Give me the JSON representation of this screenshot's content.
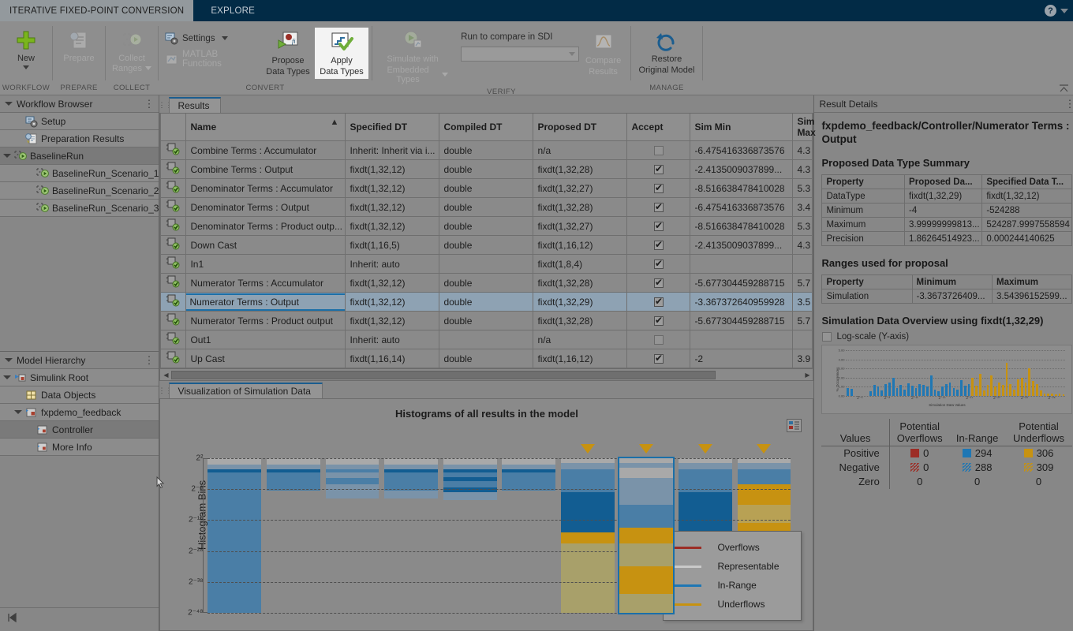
{
  "titlebar": {
    "active_tab": "ITERATIVE FIXED-POINT CONVERSION",
    "inactive_tab": "EXPLORE",
    "help_icon": "question-mark-icon"
  },
  "ribbon": {
    "groups": [
      {
        "label": "WORKFLOW",
        "items": [
          {
            "label_line1": "New",
            "label_line2": "",
            "state": "enabled",
            "dropdown": true,
            "icon": "green-plus-icon"
          }
        ]
      },
      {
        "label": "PREPARE",
        "items": [
          {
            "label_line1": "Prepare",
            "label_line2": "",
            "state": "disabled",
            "dropdown": false,
            "icon": "prepare-document-icon"
          }
        ]
      },
      {
        "label": "COLLECT",
        "items": [
          {
            "label_line1": "Collect",
            "label_line2": "Ranges",
            "state": "disabled",
            "dropdown": true,
            "icon": "collect-ranges-icon"
          }
        ]
      },
      {
        "label": "CONVERT",
        "items": [
          {
            "label_line1": "Settings",
            "state": "enabled",
            "dropdown": true,
            "icon": "settings-gear-icon",
            "kind": "small"
          },
          {
            "label_line1": "MATLAB Functions",
            "state": "disabled",
            "dropdown": false,
            "icon": "matlab-icon",
            "kind": "small"
          },
          {
            "label_line1": "Propose",
            "label_line2": "Data Types",
            "state": "enabled",
            "icon": "propose-data-types-icon",
            "kind": "big"
          },
          {
            "label_line1": "Apply",
            "label_line2": "Data Types",
            "state": "selected",
            "icon": "apply-data-types-icon",
            "kind": "big"
          }
        ]
      },
      {
        "label": "VERIFY",
        "items": [
          {
            "label_line1": "Simulate with",
            "label_line2": "Embedded Types",
            "state": "disabled",
            "dropdown": true,
            "icon": "simulate-icon",
            "kind": "big"
          },
          {
            "label_line1": "Run to compare in SDI",
            "kind": "combo-label"
          },
          {
            "label_line1": "Compare",
            "label_line2": "Results",
            "state": "disabled",
            "icon": "compare-results-icon",
            "kind": "big"
          }
        ]
      },
      {
        "label": "MANAGE",
        "items": [
          {
            "label_line1": "Restore",
            "label_line2": "Original Model",
            "state": "enabled",
            "icon": "restore-original-model-icon",
            "kind": "big"
          }
        ]
      }
    ],
    "sdi_combo_value": "",
    "sdi_combo_placeholder": ""
  },
  "workflow_browser": {
    "title": "Workflow Browser",
    "items": [
      {
        "label": "Setup",
        "icon": "setup-gear-icon",
        "indent": 1,
        "expandable": false,
        "selected": false
      },
      {
        "label": "Preparation Results",
        "icon": "preparation-results-icon",
        "indent": 1,
        "expandable": false,
        "selected": false
      },
      {
        "label": "BaselineRun",
        "icon": "run-icon",
        "indent": 0,
        "expandable": true,
        "selected": true
      },
      {
        "label": "BaselineRun_Scenario_1",
        "icon": "run-icon",
        "indent": 2,
        "expandable": false,
        "selected": false
      },
      {
        "label": "BaselineRun_Scenario_2",
        "icon": "run-icon",
        "indent": 2,
        "expandable": false,
        "selected": false
      },
      {
        "label": "BaselineRun_Scenario_3",
        "icon": "run-icon",
        "indent": 2,
        "expandable": false,
        "selected": false
      }
    ]
  },
  "model_hierarchy": {
    "title": "Model Hierarchy",
    "items": [
      {
        "label": "Simulink Root",
        "icon": "simulink-root-icon",
        "indent": 0,
        "expandable": true,
        "selected": false
      },
      {
        "label": "Data Objects",
        "icon": "data-objects-icon",
        "indent": 1,
        "expandable": false,
        "selected": false
      },
      {
        "label": "fxpdemo_feedback",
        "icon": "model-icon",
        "indent": 1,
        "expandable": true,
        "selected": false
      },
      {
        "label": "Controller",
        "icon": "subsystem-icon",
        "indent": 2,
        "expandable": false,
        "selected": true
      },
      {
        "label": "More Info",
        "icon": "subsystem-icon",
        "indent": 2,
        "expandable": false,
        "selected": false
      }
    ]
  },
  "results_tab": {
    "label": "Results",
    "columns": [
      "Name",
      "Specified DT",
      "Compiled DT",
      "Proposed DT",
      "Accept",
      "Sim Min",
      "Sim Max"
    ],
    "sorted_column": "Name",
    "sort_direction": "ascending",
    "rows": [
      {
        "name": "Combine Terms : Accumulator",
        "specified": "Inherit: Inherit via i...",
        "compiled": "double",
        "proposed": "n/a",
        "accept": false,
        "simmin": "-6.475416336873576",
        "simmax": "4.3",
        "selected": false
      },
      {
        "name": "Combine Terms : Output",
        "specified": "fixdt(1,32,12)",
        "compiled": "double",
        "proposed": "fixdt(1,32,28)",
        "accept": true,
        "simmin": "-2.4135009037899...",
        "simmax": "4.3",
        "selected": false
      },
      {
        "name": "Denominator Terms : Accumulator",
        "specified": "fixdt(1,32,12)",
        "compiled": "double",
        "proposed": "fixdt(1,32,27)",
        "accept": true,
        "simmin": "-8.516638478410028",
        "simmax": "5.3",
        "selected": false
      },
      {
        "name": "Denominator Terms : Output",
        "specified": "fixdt(1,32,12)",
        "compiled": "double",
        "proposed": "fixdt(1,32,28)",
        "accept": true,
        "simmin": "-6.475416336873576",
        "simmax": "3.4",
        "selected": false
      },
      {
        "name": "Denominator Terms : Product outp...",
        "specified": "fixdt(1,32,12)",
        "compiled": "double",
        "proposed": "fixdt(1,32,27)",
        "accept": true,
        "simmin": "-8.516638478410028",
        "simmax": "5.3",
        "selected": false
      },
      {
        "name": "Down Cast",
        "specified": "fixdt(1,16,5)",
        "compiled": "double",
        "proposed": "fixdt(1,16,12)",
        "accept": true,
        "simmin": "-2.4135009037899...",
        "simmax": "4.3",
        "selected": false
      },
      {
        "name": "In1",
        "specified": "Inherit: auto",
        "compiled": "",
        "proposed": "fixdt(1,8,4)",
        "accept": true,
        "simmin": "",
        "simmax": "",
        "selected": false
      },
      {
        "name": "Numerator Terms : Accumulator",
        "specified": "fixdt(1,32,12)",
        "compiled": "double",
        "proposed": "fixdt(1,32,28)",
        "accept": true,
        "simmin": "-5.677304459288715",
        "simmax": "5.7",
        "selected": false
      },
      {
        "name": "Numerator Terms : Output",
        "specified": "fixdt(1,32,12)",
        "compiled": "double",
        "proposed": "fixdt(1,32,29)",
        "accept": true,
        "simmin": "-3.367372640959928",
        "simmax": "3.5",
        "selected": true
      },
      {
        "name": "Numerator Terms : Product output",
        "specified": "fixdt(1,32,12)",
        "compiled": "double",
        "proposed": "fixdt(1,32,28)",
        "accept": true,
        "simmin": "-5.677304459288715",
        "simmax": "5.7",
        "selected": false
      },
      {
        "name": "Out1",
        "specified": "Inherit: auto",
        "compiled": "",
        "proposed": "n/a",
        "accept": false,
        "simmin": "",
        "simmax": "",
        "selected": false
      },
      {
        "name": "Up Cast",
        "specified": "fixdt(1,16,14)",
        "compiled": "double",
        "proposed": "fixdt(1,16,12)",
        "accept": true,
        "simmin": "-2",
        "simmax": "3.9",
        "selected": false
      }
    ]
  },
  "visualization": {
    "tab_label": "Visualization of Simulation Data",
    "legend_button_icon": "legend-toggle-icon",
    "chart_data": {
      "type": "heatmap",
      "title": "Histograms of all results in the model",
      "xlabel": "",
      "ylabel": "Histogram Bins",
      "ytick_labels": [
        "2²",
        "2⁻⁸",
        "2⁻¹⁸",
        "2⁻²⁸",
        "2⁻³⁸",
        "2⁻⁴⁸"
      ],
      "ytick_exponents": [
        2,
        -8,
        -18,
        -28,
        -38,
        -48
      ],
      "grid": true,
      "legend_position": "bottom-right",
      "legend": [
        {
          "label": "Overflows",
          "color": "#9c2d26"
        },
        {
          "label": "Representable",
          "color": "#c9c9c9"
        },
        {
          "label": "In-Range",
          "color": "#1f77b4"
        },
        {
          "label": "Underflows",
          "color": "#c79211"
        }
      ],
      "marker_columns": [
        7,
        8,
        9,
        10
      ],
      "selected_column": 8,
      "columns": [
        {
          "index": 1,
          "segments": [
            [
              0,
              4,
              "rep"
            ],
            [
              4,
              7,
              "in-light"
            ],
            [
              7,
              9,
              "in-dark"
            ],
            [
              9,
              100,
              "in-mid"
            ]
          ]
        },
        {
          "index": 2,
          "segments": [
            [
              0,
              4,
              "rep"
            ],
            [
              4,
              7,
              "in-light"
            ],
            [
              7,
              9,
              "in-dark"
            ],
            [
              9,
              21,
              "in-mid"
            ],
            [
              21,
              100,
              "none"
            ]
          ]
        },
        {
          "index": 3,
          "segments": [
            [
              0,
              4,
              "rep"
            ],
            [
              4,
              7,
              "in-light"
            ],
            [
              7,
              9,
              "in-mid"
            ],
            [
              9,
              13,
              "in-light"
            ],
            [
              13,
              17,
              "in-mid"
            ],
            [
              17,
              21,
              "in-light"
            ],
            [
              21,
              26,
              "in-light"
            ],
            [
              26,
              60,
              "none"
            ],
            [
              60,
              100,
              "none"
            ]
          ]
        },
        {
          "index": 4,
          "segments": [
            [
              0,
              4,
              "rep"
            ],
            [
              4,
              7,
              "in-light"
            ],
            [
              7,
              9,
              "in-dark"
            ],
            [
              9,
              21,
              "in-mid"
            ],
            [
              21,
              26,
              "in-light"
            ],
            [
              26,
              100,
              "none"
            ]
          ]
        },
        {
          "index": 5,
          "segments": [
            [
              0,
              4,
              "rep"
            ],
            [
              4,
              7,
              "in-light"
            ],
            [
              7,
              9,
              "in-dark"
            ],
            [
              9,
              12,
              "in-mid"
            ],
            [
              12,
              15,
              "in-dark"
            ],
            [
              15,
              19,
              "in-mid"
            ],
            [
              19,
              22,
              "in-dark"
            ],
            [
              22,
              27,
              "in-light"
            ],
            [
              27,
              60,
              "none"
            ]
          ]
        },
        {
          "index": 6,
          "segments": [
            [
              0,
              4,
              "rep"
            ],
            [
              4,
              7,
              "in-light"
            ],
            [
              7,
              9,
              "in-dark"
            ],
            [
              9,
              21,
              "in-mid"
            ],
            [
              21,
              100,
              "none"
            ]
          ]
        },
        {
          "index": 7,
          "segments": [
            [
              0,
              3,
              "rep"
            ],
            [
              3,
              7,
              "in-light"
            ],
            [
              7,
              22,
              "in-mid"
            ],
            [
              22,
              48,
              "in-dark"
            ],
            [
              48,
              55,
              "un-dark"
            ],
            [
              55,
              100,
              "un-light"
            ]
          ]
        },
        {
          "index": 8,
          "segments": [
            [
              0,
              3,
              "rep"
            ],
            [
              3,
              6,
              "in-light"
            ],
            [
              6,
              13,
              "rep"
            ],
            [
              13,
              30,
              "in-light"
            ],
            [
              30,
              45,
              "in-mid"
            ],
            [
              45,
              55,
              "un-dark"
            ],
            [
              55,
              70,
              "un-light"
            ],
            [
              70,
              88,
              "un-dark"
            ],
            [
              88,
              100,
              "un-light"
            ]
          ]
        },
        {
          "index": 9,
          "segments": [
            [
              0,
              3,
              "rep"
            ],
            [
              3,
              7,
              "in-light"
            ],
            [
              7,
              22,
              "in-mid"
            ],
            [
              22,
              48,
              "in-dark"
            ],
            [
              48,
              55,
              "un-dark"
            ],
            [
              55,
              62,
              "un-light"
            ],
            [
              62,
              100,
              "none"
            ]
          ]
        },
        {
          "index": 10,
          "segments": [
            [
              0,
              3,
              "rep"
            ],
            [
              3,
              7,
              "in-light"
            ],
            [
              7,
              17,
              "in-mid"
            ],
            [
              17,
              30,
              "un-dark"
            ],
            [
              30,
              42,
              "un-mid"
            ],
            [
              42,
              52,
              "un-dark"
            ],
            [
              52,
              100,
              "none"
            ]
          ]
        }
      ]
    }
  },
  "result_details": {
    "title": "Result Details",
    "path": "fxpdemo_feedback/Controller/Numerator Terms : Output",
    "proposed_summary_heading": "Proposed Data Type Summary",
    "proposed_summary": {
      "columns": [
        "Property",
        "Proposed Da...",
        "Specified Data T..."
      ],
      "rows": [
        [
          "DataType",
          "fixdt(1,32,29)",
          "fixdt(1,32,12)"
        ],
        [
          "Minimum",
          "-4",
          "-524288"
        ],
        [
          "Maximum",
          "3.99999999813...",
          "524287.9997558594"
        ],
        [
          "Precision",
          "1.86264514923...",
          "0.000244140625"
        ]
      ]
    },
    "ranges_heading": "Ranges used for proposal",
    "ranges": {
      "columns": [
        "Property",
        "Minimum",
        "Maximum"
      ],
      "rows": [
        [
          "Simulation",
          "-3.3673726409...",
          "3.54396152599..."
        ]
      ]
    },
    "overview_heading": "Simulation Data Overview using fixdt(1,32,29)",
    "log_scale_label": "Log-scale (Y-axis)",
    "log_scale_checked": false,
    "chart_data": {
      "type": "bar",
      "title": "",
      "xlabel": "Simulation Data Values",
      "ylabel": "% Occurrences",
      "ytick_labels": [
        "0.00",
        "1.00",
        "2.00",
        "3.00",
        "4.00",
        "5.00"
      ],
      "ylim": [
        0,
        5
      ],
      "xtick_labels": [
        "2⁻⁵",
        "2⁻⁸",
        "2⁻¹¹",
        "2⁻¹⁴",
        "2⁻¹⁷",
        "2⁻²⁰",
        "2⁻²³",
        "2⁻²⁶"
      ],
      "series": [
        {
          "name": "In-Range",
          "color": "#1f77b4",
          "values": [
            0.9,
            0.8,
            0,
            0,
            0,
            0,
            0.5,
            1.2,
            1.0,
            0.6,
            1.3,
            1.5,
            2.0,
            0.9,
            1.2,
            0.7,
            1.4,
            1.1,
            0.9,
            1.3,
            1.2,
            1.0,
            2.2,
            0.7,
            0.5,
            1.0,
            1.3,
            1.5,
            0.9,
            0.7,
            1.7,
            1.1,
            1.3
          ]
        },
        {
          "name": "Underflows",
          "color": "#c79211",
          "values": [
            2.0,
            1.1,
            2.4,
            0.6,
            1.2,
            2.2,
            1.0,
            1.5,
            1.2,
            3.6,
            1.3,
            0.7,
            1.8,
            2.0,
            1.5,
            3.0,
            1.6,
            1.3,
            0.6,
            0.3,
            0.25,
            0.3,
            0.2,
            0.25,
            0.2
          ]
        }
      ]
    },
    "stats_table": {
      "col_headers": [
        "Values",
        "Potential Overflows",
        "In-Range",
        "Potential Underflows"
      ],
      "row_labels": [
        "Positive",
        "Negative",
        "Zero"
      ],
      "values": [
        [
          "0",
          "294",
          "306"
        ],
        [
          "0",
          "288",
          "309"
        ],
        [
          "0",
          "0",
          "0"
        ]
      ],
      "colors": {
        "overflow": "#9c2d26",
        "inrange": "#1f77b4",
        "underflow": "#c79211"
      }
    }
  }
}
